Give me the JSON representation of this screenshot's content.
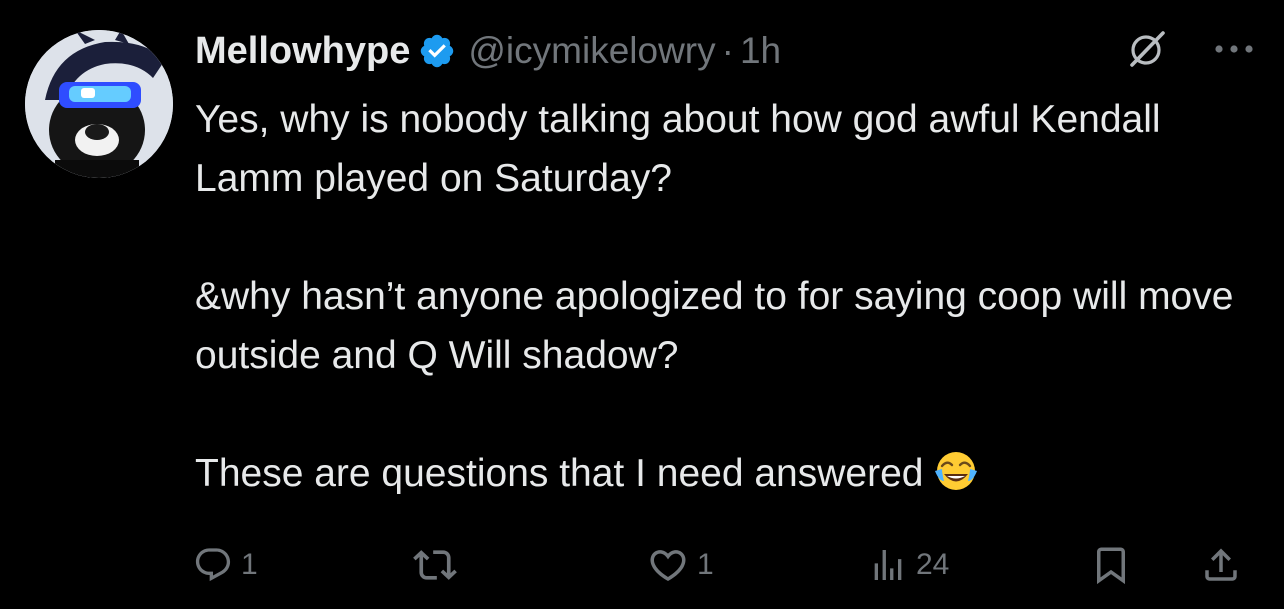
{
  "tweet": {
    "author": {
      "display_name": "Mellowhype",
      "handle": "@icymikelowry",
      "separator": "·",
      "time": "1h",
      "verified": true
    },
    "body": [
      "Yes, why is nobody talking about how god awful Kendall Lamm played on Saturday?",
      "&why hasn’t anyone apologized to for saying coop will move outside and Q Will shadow?",
      "These are questions that I need answered"
    ],
    "body_emoji": "face-with-tears-of-joy-emoji",
    "top_actions": [
      "grok-icon",
      "more-options-icon"
    ],
    "actions": {
      "reply": {
        "icon": "reply-icon",
        "count": "1"
      },
      "repost": {
        "icon": "repost-icon",
        "count": ""
      },
      "like": {
        "icon": "like-icon",
        "count": "1"
      },
      "views": {
        "icon": "views-icon",
        "count": "24"
      },
      "bookmark": {
        "icon": "bookmark-icon"
      },
      "share": {
        "icon": "share-icon"
      }
    }
  },
  "colors": {
    "background": "#000000",
    "primary_text": "#e7e9ea",
    "secondary_text": "#71767b",
    "verified_badge": "#1d9bf0"
  }
}
